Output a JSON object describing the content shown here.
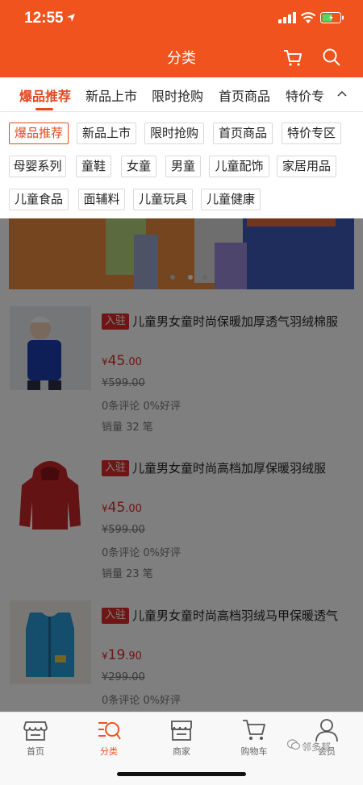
{
  "status_bar": {
    "time": "12:55"
  },
  "header": {
    "title": "分类"
  },
  "tabs": {
    "items": [
      "爆品推荐",
      "新品上市",
      "限时抢购",
      "首页商品",
      "特价专"
    ],
    "active_index": 0
  },
  "categories": {
    "rows": [
      [
        "爆品推荐",
        "新品上市",
        "限时抢购",
        "首页商品",
        "特价专区"
      ],
      [
        "母婴系列",
        "童鞋",
        "女童",
        "男童",
        "儿童配饰",
        "家居用品"
      ],
      [
        "儿童食品",
        "面辅料",
        "儿童玩具",
        "儿童健康"
      ]
    ],
    "selected": "爆品推荐"
  },
  "products": [
    {
      "badge": "入驻",
      "title": "儿童男女童时尚保暖加厚透气羽绒棉服",
      "price_currency": "¥",
      "price_main": "45",
      "price_decimal": ".00",
      "old_price": "¥599.00",
      "reviews": "0条评论 0%好评",
      "sales": "销量 32 笔"
    },
    {
      "badge": "入驻",
      "title": "儿童男女童时尚高档加厚保暖羽绒服",
      "price_currency": "¥",
      "price_main": "45",
      "price_decimal": ".00",
      "old_price": "¥599.00",
      "reviews": "0条评论 0%好评",
      "sales": "销量 23 笔"
    },
    {
      "badge": "入驻",
      "title": "儿童男女童时尚高档羽绒马甲保暖透气",
      "price_currency": "¥",
      "price_main": "19",
      "price_decimal": ".90",
      "old_price": "¥299.00",
      "reviews": "0条评论 0%好评",
      "sales": ""
    }
  ],
  "bottom_nav": {
    "items": [
      {
        "label": "首页",
        "icon": "store-icon"
      },
      {
        "label": "分类",
        "icon": "category-search-icon"
      },
      {
        "label": "商家",
        "icon": "shop-icon"
      },
      {
        "label": "购物车",
        "icon": "cart-icon"
      },
      {
        "label": "会员",
        "icon": "user-icon"
      }
    ],
    "active_index": 1
  },
  "watermark": "邻多邦",
  "colors": {
    "brand": "#f0531d",
    "accent": "#e4491f",
    "price": "#e02a2a"
  }
}
